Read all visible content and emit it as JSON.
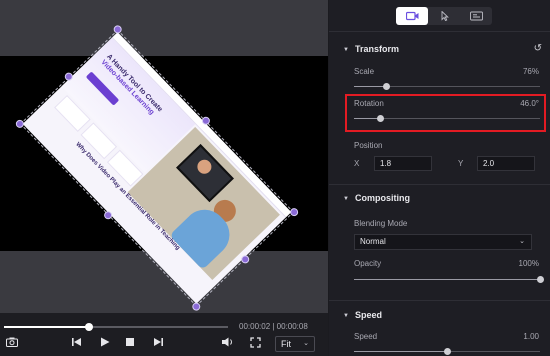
{
  "player": {
    "time_display": "00:00:02 | 00:00:08",
    "zoom_label": "Fit",
    "seek_progress": 0.38
  },
  "canvas": {
    "rotation_degrees": 46,
    "webpage": {
      "headline_part1": "A Handy Tool to Create",
      "headline_part2": "Video-based Learning",
      "subheading": "Why Does Video Play an Essential Role in Teaching"
    }
  },
  "panel": {
    "tabs": [
      {
        "icon": "video-icon",
        "active": true
      },
      {
        "icon": "cursor-icon",
        "active": false
      },
      {
        "icon": "caption-icon",
        "active": false
      }
    ],
    "transform": {
      "title": "Transform",
      "scale_label": "Scale",
      "scale_value": "76%",
      "scale_fraction": 0.17,
      "rotation_label": "Rotation",
      "rotation_value": "46.0°",
      "rotation_fraction": 0.14,
      "position_label": "Position",
      "x_label": "X",
      "x_value": "1.8",
      "y_label": "Y",
      "y_value": "2.0"
    },
    "compositing": {
      "title": "Compositing",
      "blending_label": "Blending Mode",
      "blending_value": "Normal",
      "opacity_label": "Opacity",
      "opacity_value": "100%",
      "opacity_fraction": 1.0
    },
    "speed": {
      "title": "Speed",
      "speed_label": "Speed",
      "speed_value": "1.00",
      "speed_fraction": 0.5
    }
  },
  "colors": {
    "highlight": "#e31b23",
    "handle": "#8a6ad6",
    "brand_purple": "#6b3fd1"
  }
}
